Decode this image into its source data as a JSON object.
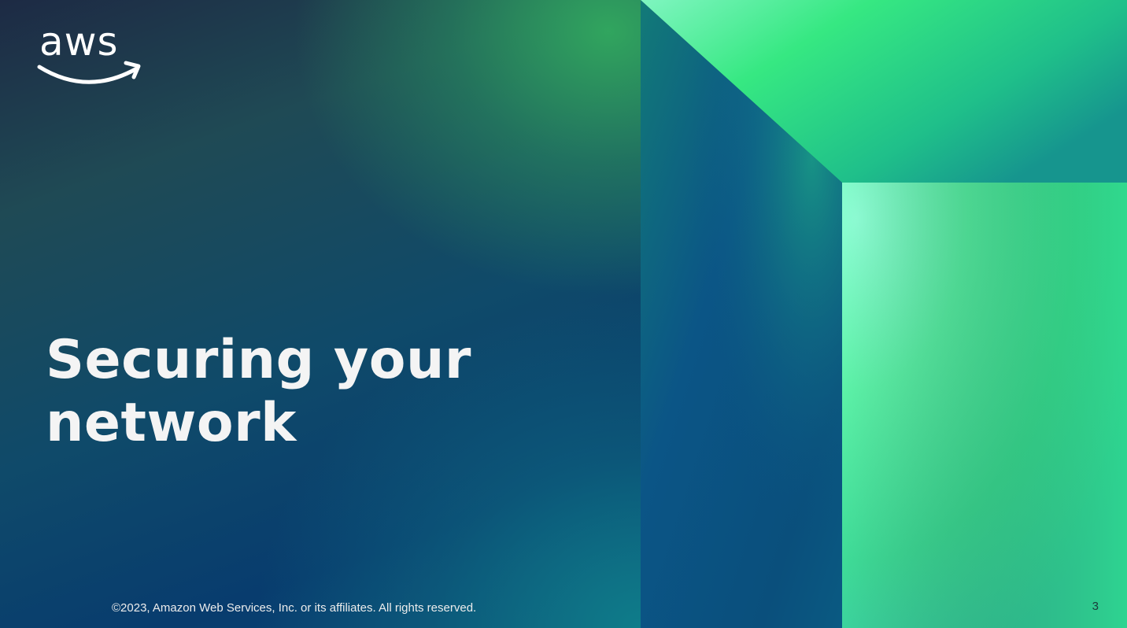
{
  "slide": {
    "title_line1": "Securing your",
    "title_line2": "network",
    "footer": "©2023, Amazon Web Services, Inc. or its affiliates. All rights reserved.",
    "page_number": "3"
  },
  "logo": {
    "text": "aws",
    "icon": "aws-logo-icon"
  },
  "colors": {
    "title_text": "#f4f4f4",
    "bright_green": "#3ee87e",
    "mint": "#8affd4",
    "deep_blue": "#0b3f74"
  }
}
